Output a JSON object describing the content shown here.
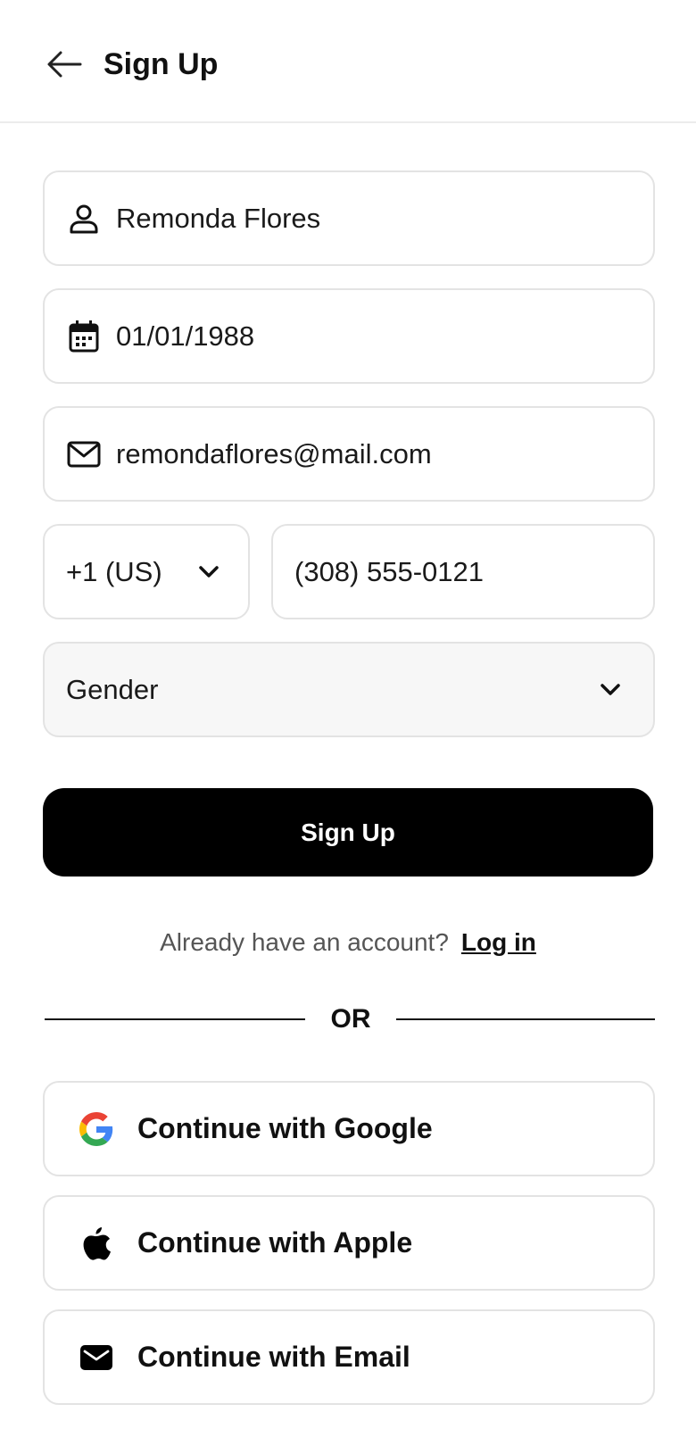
{
  "header": {
    "title": "Sign Up"
  },
  "form": {
    "name_value": "Remonda Flores",
    "dob_value": "01/01/1988",
    "email_value": "remondaflores@mail.com",
    "country_code": "+1 (US)",
    "phone_value": "(308) 555-0121",
    "gender_placeholder": "Gender"
  },
  "actions": {
    "signup_label": "Sign Up",
    "already_text": "Already have an account?",
    "login_label": "Log in",
    "or_text": "OR"
  },
  "social": {
    "google_label": "Continue with Google",
    "apple_label": "Continue with Apple",
    "email_label": "Continue with Email"
  },
  "icons": {
    "back": "arrow-left-icon",
    "name": "user-icon",
    "dob": "calendar-icon",
    "email": "mail-icon",
    "dropdown": "chevron-down-icon",
    "google": "google-icon",
    "apple": "apple-icon",
    "email_solid": "mail-solid-icon"
  },
  "colors": {
    "primary": "#000000",
    "border": "#e3e3e3",
    "select_bg": "#f7f7f7"
  }
}
